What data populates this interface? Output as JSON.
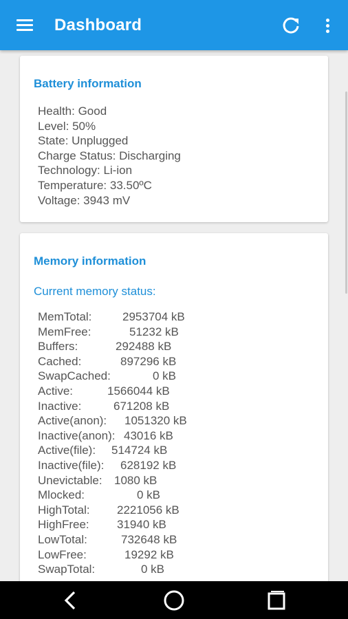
{
  "appbar": {
    "title": "Dashboard",
    "icons": {
      "menu": "hamburger-menu-icon",
      "refresh": "refresh-icon",
      "more": "more-vertical-icon"
    },
    "color": "#1e96e6"
  },
  "battery": {
    "title": "Battery information",
    "lines": [
      "Health: Good",
      "Level: 50%",
      "State: Unplugged",
      "Charge Status: Discharging",
      "Technology: Li-ion",
      "Temperature: 33.50ºC",
      "Voltage: 3943 mV"
    ]
  },
  "memory": {
    "title": "Memory information",
    "subtitle": "Current memory status:",
    "rows": [
      {
        "key": "MemTotal:",
        "value": "2953704 kB"
      },
      {
        "key": "MemFree:",
        "value": "51232 kB"
      },
      {
        "key": "Buffers:",
        "value": "292488 kB"
      },
      {
        "key": "Cached:",
        "value": "897296 kB"
      },
      {
        "key": "SwapCached:",
        "value": "0 kB"
      },
      {
        "key": "Active:",
        "value": "1566044 kB"
      },
      {
        "key": "Inactive:",
        "value": "671208 kB"
      },
      {
        "key": "Active(anon):",
        "value": "1051320 kB"
      },
      {
        "key": "Inactive(anon):",
        "value": "43016 kB"
      },
      {
        "key": "Active(file):",
        "value": "514724 kB"
      },
      {
        "key": "Inactive(file):",
        "value": "628192 kB"
      },
      {
        "key": "Unevictable:",
        "value": "1080 kB"
      },
      {
        "key": "Mlocked:",
        "value": "0 kB"
      },
      {
        "key": "HighTotal:",
        "value": "2221056 kB"
      },
      {
        "key": "HighFree:",
        "value": "31940 kB"
      },
      {
        "key": "LowTotal:",
        "value": "732648 kB"
      },
      {
        "key": "LowFree:",
        "value": "19292 kB"
      },
      {
        "key": "SwapTotal:",
        "value": "0 kB"
      }
    ]
  },
  "navbar": {
    "icons": {
      "back": "back-icon",
      "home": "home-icon",
      "recents": "recents-icon"
    }
  },
  "colors": {
    "accent": "#1e8fd8",
    "text": "#555555",
    "background": "#eeeeee"
  }
}
